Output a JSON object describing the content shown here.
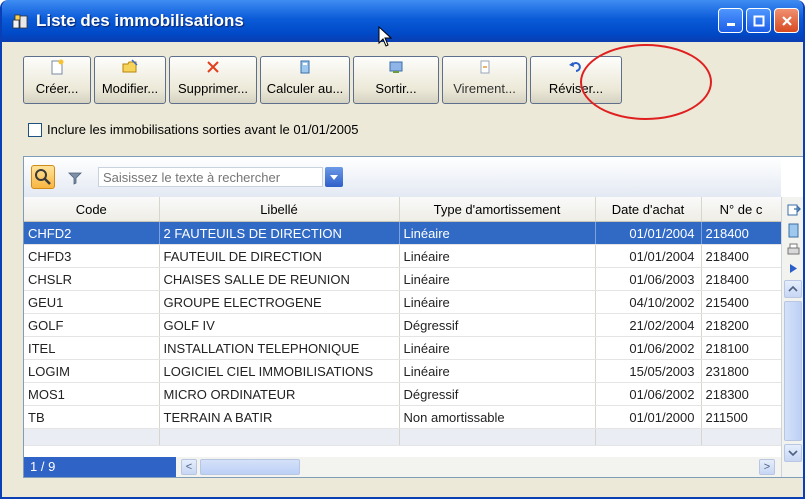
{
  "window": {
    "title": "Liste des immobilisations"
  },
  "toolbar": {
    "buttons": [
      {
        "label": "Créer...",
        "icon": "new-document-icon"
      },
      {
        "label": "Modifier...",
        "icon": "open-folder-icon"
      },
      {
        "label": "Supprimer...",
        "icon": "delete-x-icon"
      },
      {
        "label": "Calculer au...",
        "icon": "calculate-icon"
      },
      {
        "label": "Sortir...",
        "icon": "exit-asset-icon"
      },
      {
        "label": "Virement...",
        "icon": "transfer-icon"
      },
      {
        "label": "Réviser...",
        "icon": "revise-undo-icon"
      }
    ]
  },
  "filter": {
    "include_label": "Inclure les immobilisations sorties avant le 01/01/2005",
    "include_checked": false
  },
  "search": {
    "placeholder": "Saisissez le texte à rechercher"
  },
  "table": {
    "columns": [
      "Code",
      "Libellé",
      "Type d'amortissement",
      "Date d'achat",
      "N° de c"
    ],
    "rows": [
      {
        "code": "CHFD2",
        "libelle": "2 FAUTEUILS DE DIRECTION",
        "type": "Linéaire",
        "date": "01/01/2004",
        "compte": "218400",
        "selected": true
      },
      {
        "code": "CHFD3",
        "libelle": "FAUTEUIL DE DIRECTION",
        "type": "Linéaire",
        "date": "01/01/2004",
        "compte": "218400"
      },
      {
        "code": "CHSLR",
        "libelle": "CHAISES SALLE DE REUNION",
        "type": "Linéaire",
        "date": "01/06/2003",
        "compte": "218400"
      },
      {
        "code": "GEU1",
        "libelle": "GROUPE ELECTROGENE",
        "type": "Linéaire",
        "date": "04/10/2002",
        "compte": "215400"
      },
      {
        "code": "GOLF",
        "libelle": "GOLF IV",
        "type": "Dégressif",
        "date": "21/02/2004",
        "compte": "218200"
      },
      {
        "code": "ITEL",
        "libelle": "INSTALLATION TELEPHONIQUE",
        "type": "Linéaire",
        "date": "01/06/2002",
        "compte": "218100"
      },
      {
        "code": "LOGIM",
        "libelle": "LOGICIEL CIEL IMMOBILISATIONS",
        "type": "Linéaire",
        "date": "15/05/2003",
        "compte": "231800"
      },
      {
        "code": "MOS1",
        "libelle": "MICRO ORDINATEUR",
        "type": "Dégressif",
        "date": "01/06/2002",
        "compte": "218300"
      },
      {
        "code": "TB",
        "libelle": "TERRAIN A BATIR",
        "type": "Non amortissable",
        "date": "01/01/2000",
        "compte": "211500"
      }
    ]
  },
  "status": {
    "record_position": "1 / 9"
  },
  "colors": {
    "titlebar": "#0b5bd8",
    "selection": "#316ac5",
    "highlight_circle": "#e02020"
  }
}
